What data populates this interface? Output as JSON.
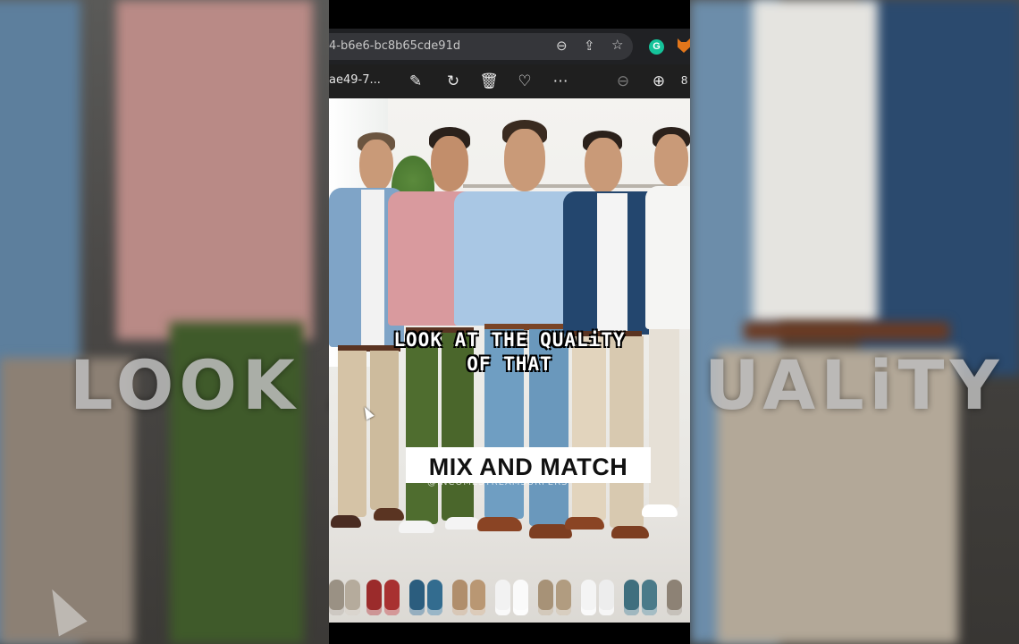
{
  "browser": {
    "url_fragment": "4-b6e6-bc8b65cde91d",
    "icons": [
      "zoom-out-icon",
      "share-icon",
      "bookmark-star-icon",
      "grammarly-extension-icon",
      "metamask-extension-icon"
    ],
    "grammarly_letter": "G"
  },
  "viewer": {
    "file_name": "ae49-7...",
    "zoom_partial": "8"
  },
  "video": {
    "caption_line1": "LOOK AT THE QUALiTY",
    "caption_line2": "OF THAT",
    "overlay_title": "MIX AND MATCH",
    "watermark": "@INCOMESTREAMSURFERS"
  },
  "background": {
    "left_text": "LOOK  A",
    "right_text": "UALiTY"
  },
  "colors": {
    "pink_shirt": "#d99a9e",
    "light_blue_shirt": "#a9c7e4",
    "navy_blazer": "#23466e",
    "light_blue_blazer": "#7fa4c7",
    "green_trousers": "#4f6d2f",
    "khaki_trousers": "#d5c3a6",
    "brown_shoes": "#8a4424"
  }
}
